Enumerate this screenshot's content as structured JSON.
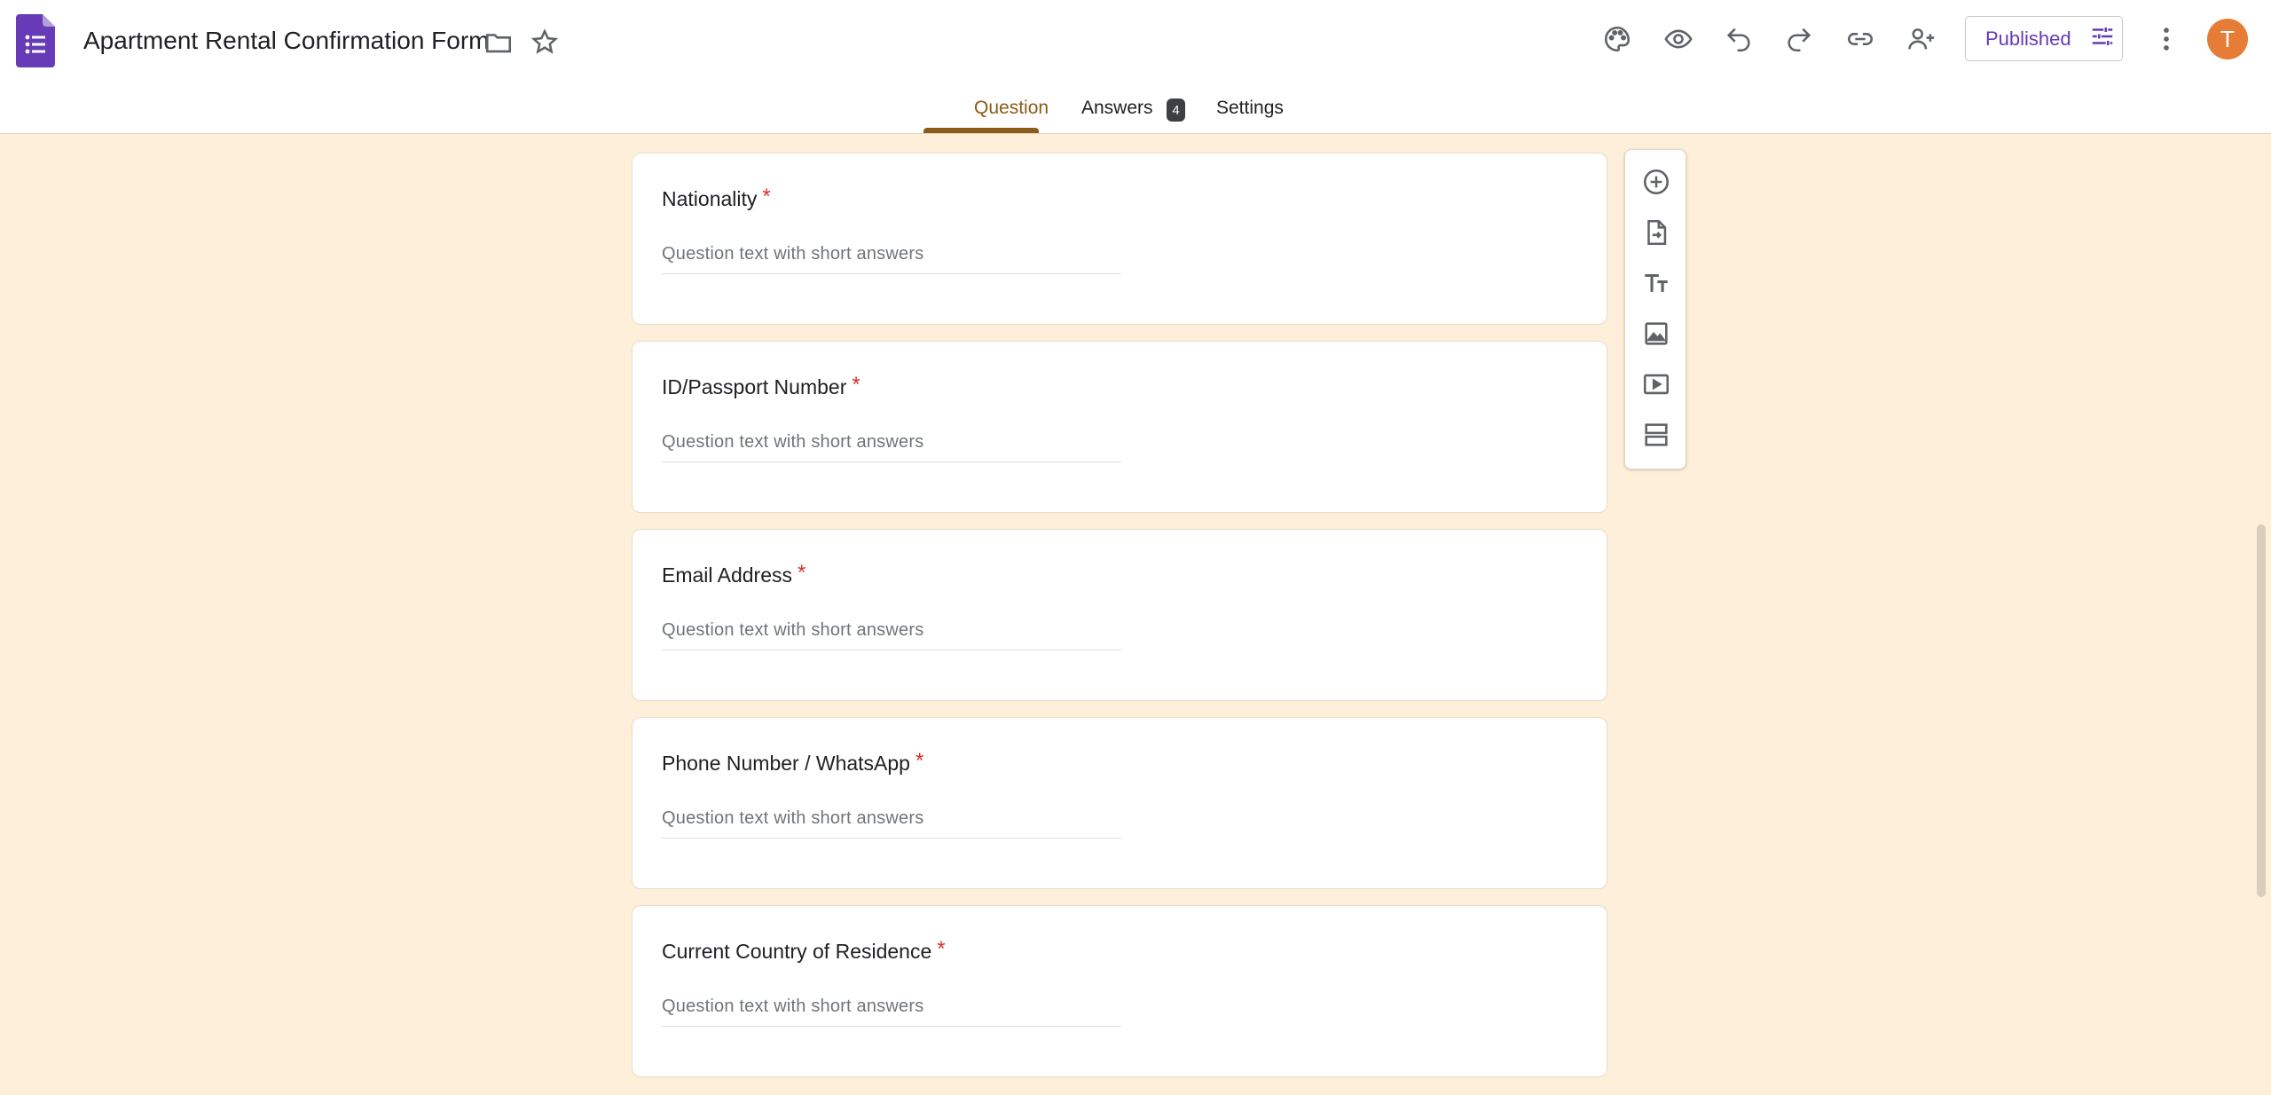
{
  "header": {
    "title": "Apartment Rental Confirmation Form",
    "publish_label": "Published",
    "avatar_letter": "T"
  },
  "tabs": [
    {
      "label": "Question"
    },
    {
      "label": "Answers",
      "badge": "4"
    },
    {
      "label": "Settings"
    }
  ],
  "questions": [
    {
      "title": "Nationality",
      "required": "*",
      "placeholder": "Question text with short answers"
    },
    {
      "title": "ID/Passport Number",
      "required": "*",
      "placeholder": "Question text with short answers"
    },
    {
      "title": "Email Address",
      "required": "*",
      "placeholder": "Question text with short answers"
    },
    {
      "title": "Phone Number / WhatsApp",
      "required": "*",
      "placeholder": "Question text with short answers"
    },
    {
      "title": "Current Country of Residence",
      "required": "*",
      "placeholder": "Question text with short answers"
    }
  ],
  "colors": {
    "page_bg": "#fdefda",
    "accent_tab": "#8a5a16",
    "brand_purple": "#673ab7",
    "avatar": "#e67c36",
    "required": "#d93025"
  },
  "icons": {
    "header": [
      "palette-icon",
      "eye-icon",
      "undo-icon",
      "redo-icon",
      "link-icon",
      "add-person-icon",
      "sliders-icon",
      "more-vert-icon"
    ],
    "toolbar": [
      "add-circle-icon",
      "import-file-icon",
      "text-icon",
      "image-icon",
      "video-icon",
      "section-icon"
    ]
  }
}
